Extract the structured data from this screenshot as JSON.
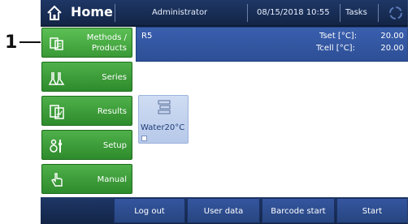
{
  "callout": {
    "number": "1"
  },
  "header": {
    "title": "Home",
    "user": "Administrator",
    "datetime": "08/15/2018  10:55",
    "tasks": "Tasks",
    "colors": {
      "bar": "#1e3766",
      "text": "#ffffff"
    }
  },
  "sidebar": {
    "items": [
      {
        "label_line1": "Methods /",
        "label_line2": "Products",
        "icon": "methods-icon"
      },
      {
        "label": "Series",
        "icon": "flask-icon"
      },
      {
        "label": "Results",
        "icon": "results-icon"
      },
      {
        "label": "Setup",
        "icon": "setup-icon"
      },
      {
        "label": "Manual",
        "icon": "hand-icon"
      }
    ],
    "color": "#3a9a36"
  },
  "method_bar": {
    "name": "R5",
    "tset_label": "Tset [°C]:",
    "tset_value": "20.00",
    "tcell_label": "Tcell [°C]:",
    "tcell_value": "20.00"
  },
  "tiles": [
    {
      "label": "Water20°C",
      "icon": "method-list-icon"
    }
  ],
  "footer": {
    "buttons": [
      "Log out",
      "User data",
      "Barcode start",
      "Start"
    ]
  }
}
